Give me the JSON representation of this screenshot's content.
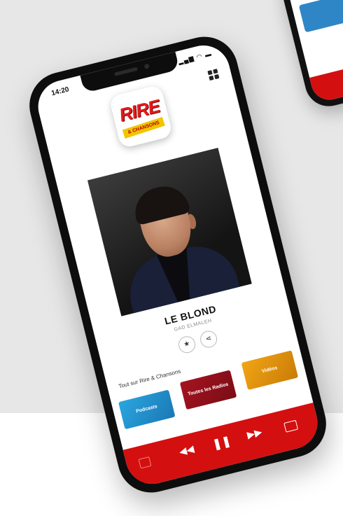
{
  "status": {
    "time": "14:20",
    "icons": "▂▄▆ ◠ ▬"
  },
  "station": {
    "logo_top": "RIRE",
    "logo_bottom": "& CHANSONS",
    "brand_color": "#d40f0f"
  },
  "now_playing": {
    "title": "LE BLOND",
    "artist": "GAD ELMALEH"
  },
  "actions": {
    "favorite": "★",
    "share": "⋖"
  },
  "section": {
    "title": "Tout sur Rire & Chansons"
  },
  "tiles": [
    {
      "label": "Podcasts",
      "color": "#2aa6df"
    },
    {
      "label": "Toutes les Radios",
      "color": "#a5131f"
    },
    {
      "label": "Vidéos",
      "color": "#f1a515"
    }
  ],
  "player": {
    "rewind": "◀◀",
    "pause": "❚❚",
    "forward": "▶▶"
  }
}
